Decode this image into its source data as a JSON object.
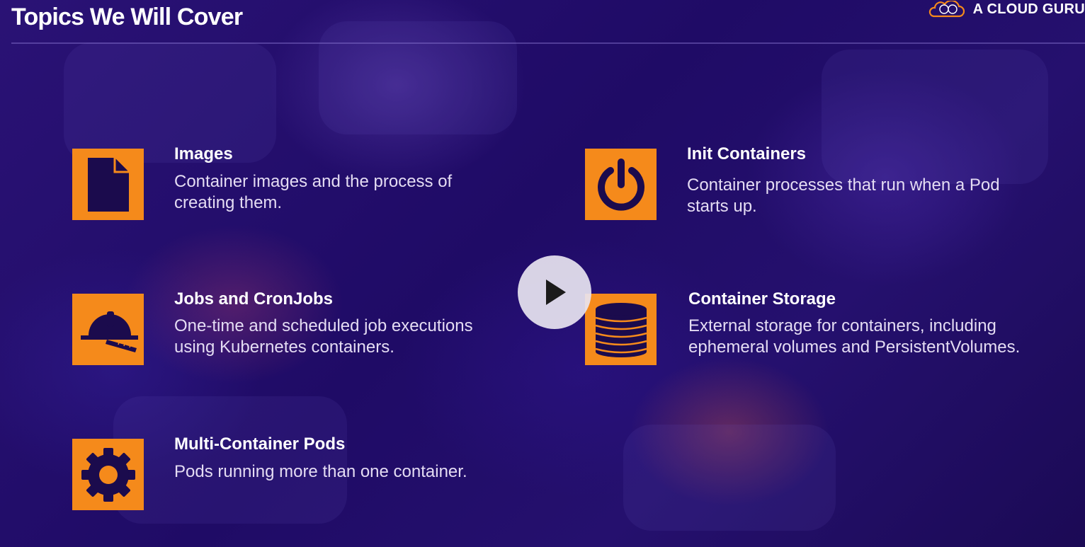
{
  "header": {
    "title": "Topics We Will Cover",
    "brand": "A CLOUD GURU"
  },
  "topics": [
    {
      "title": "Images",
      "description": "Container images and the process of creating them.",
      "icon": "document-icon"
    },
    {
      "title": "Init Containers",
      "description": "Container processes that run when a Pod starts up.",
      "icon": "power-icon"
    },
    {
      "title": "Jobs and CronJobs",
      "description": "One-time and scheduled job executions using Kubernetes containers.",
      "icon": "hard-hat-icon"
    },
    {
      "title": "Container Storage",
      "description": "External storage for containers, including ephemeral volumes and PersistentVolumes.",
      "icon": "database-icon"
    },
    {
      "title": "Multi-Container Pods",
      "description": "Pods running more than one container.",
      "icon": "gear-icon"
    }
  ],
  "player": {
    "icon": "play-icon"
  },
  "colors": {
    "accent": "#f58a1b",
    "icon_glyph": "#1b0b4d",
    "background": "#1e0a5c"
  }
}
